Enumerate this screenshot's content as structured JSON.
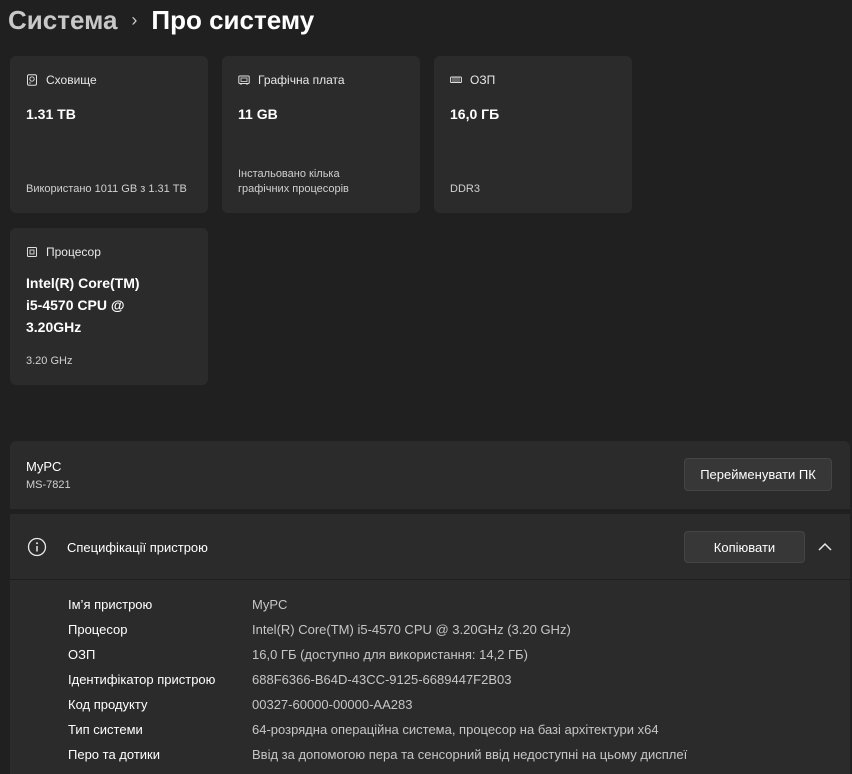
{
  "breadcrumb": {
    "parent": "Система",
    "separator": "›",
    "current": "Про систему"
  },
  "cards": {
    "storage": {
      "label": "Сховище",
      "value": "1.31 TB",
      "footer": "Використано 1011 GB з 1.31 TB"
    },
    "gpu": {
      "label": "Графічна плата",
      "value": "11 GB",
      "footer_line1": "Інстальовано кілька",
      "footer_line2": "графічних процесорів"
    },
    "ram": {
      "label": "ОЗП",
      "value": "16,0 ГБ",
      "footer": "DDR3"
    },
    "cpu": {
      "label": "Процесор",
      "value_line1": "Intel(R) Core(TM)",
      "value_line2": "i5-4570 CPU @",
      "value_line3": "3.20GHz",
      "footer": "3.20 GHz"
    }
  },
  "pc": {
    "name": "MyPC",
    "model": "MS-7821",
    "rename_label": "Перейменувати ПК"
  },
  "specs": {
    "title": "Специфікації пристрою",
    "copy_label": "Копіювати",
    "rows": [
      {
        "label": "Ім’я пристрою",
        "value": "MyPC"
      },
      {
        "label": "Процесор",
        "value": "Intel(R) Core(TM) i5-4570 CPU @ 3.20GHz (3.20 GHz)"
      },
      {
        "label": "ОЗП",
        "value": "16,0 ГБ (доступно для використання: 14,2 ГБ)"
      },
      {
        "label": "Ідентифікатор пристрою",
        "value": "688F6366-B64D-43CC-9125-6689447F2B03"
      },
      {
        "label": "Код продукту",
        "value": "00327-60000-00000-AA283"
      },
      {
        "label": "Тип системи",
        "value": "64-розрядна операційна система, процесор на базі архітектури x64"
      },
      {
        "label": "Перо та дотики",
        "value": "Ввід за допомогою пера та сенсорний ввід недоступні на цьому дисплеї"
      }
    ]
  },
  "icons": {
    "storage": "hard-drive-icon",
    "gpu": "graphics-card-icon",
    "ram": "memory-icon",
    "cpu": "processor-icon",
    "info": "info-icon",
    "collapse": "chevron-up-icon"
  }
}
